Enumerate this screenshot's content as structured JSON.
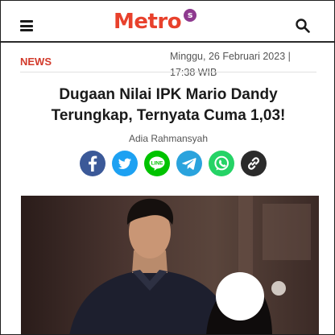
{
  "header": {
    "brand": "Metro",
    "brand_badge": "s",
    "brand_color": "#e8412c",
    "badge_color": "#8e3a8f",
    "menu_icon": "hamburger-icon",
    "search_icon": "search-icon"
  },
  "article": {
    "category": "NEWS",
    "category_color": "#d23a2b",
    "date": "Minggu, 26 Februari 2023 | 17:38 WIB",
    "title": "Dugaan Nilai IPK Mario Dandy Terungkap, Ternyata Cuma 1,03!",
    "author": "Adia Rahmansyah"
  },
  "share": [
    {
      "name": "facebook",
      "icon": "facebook-icon",
      "color": "#3b5998"
    },
    {
      "name": "twitter",
      "icon": "twitter-icon",
      "color": "#1da1f2"
    },
    {
      "name": "line",
      "icon": "line-icon",
      "color": "#00c300"
    },
    {
      "name": "telegram",
      "icon": "telegram-icon",
      "color": "#2aa3dd"
    },
    {
      "name": "whatsapp",
      "icon": "whatsapp-icon",
      "color": "#25d366"
    },
    {
      "name": "copy-link",
      "icon": "link-icon",
      "color": "#2b2b2b"
    }
  ]
}
